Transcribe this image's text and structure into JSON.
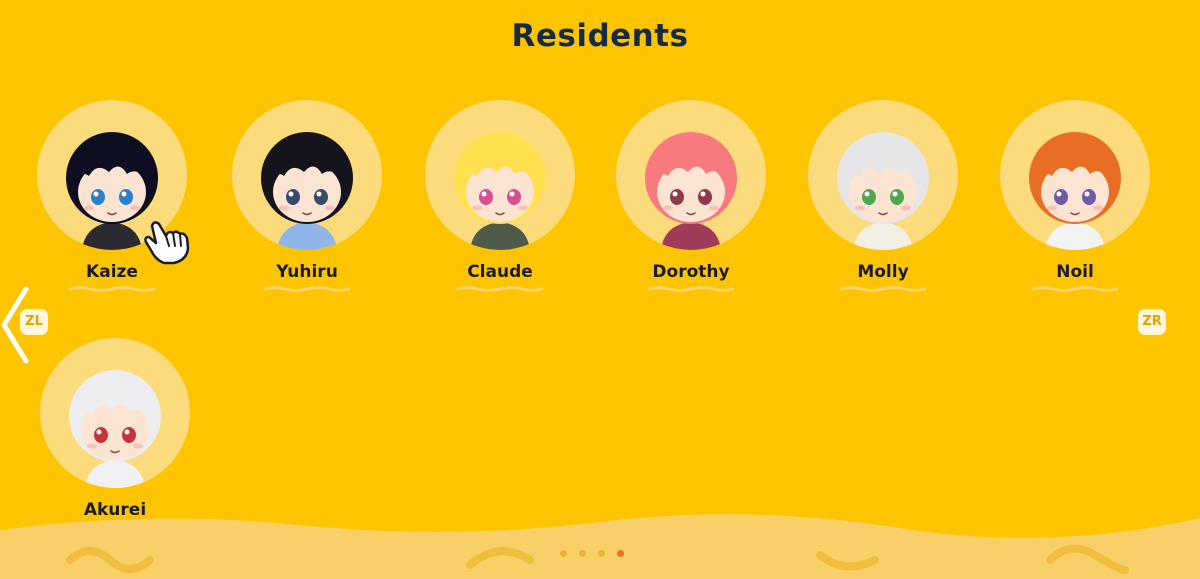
{
  "title": "Residents",
  "residents": [
    {
      "name": "Kaize",
      "hair": "#0E0E22",
      "skin": "#FBE4D2",
      "eyes": "#2E7FCB",
      "outfit": "#2A2A30"
    },
    {
      "name": "Yuhiru",
      "hair": "#15131C",
      "skin": "#FBE4D2",
      "eyes": "#3A4A6B",
      "outfit": "#8FB6E6"
    },
    {
      "name": "Claude",
      "hair": "#FFE14F",
      "skin": "#FBE4D2",
      "eyes": "#D84F8F",
      "outfit": "#4E5A4A"
    },
    {
      "name": "Dorothy",
      "hair": "#F77A7E",
      "skin": "#FBE4D2",
      "eyes": "#8E3A4C",
      "outfit": "#A03B5A"
    },
    {
      "name": "Molly",
      "hair": "#E6E6E8",
      "skin": "#FBE4D2",
      "eyes": "#4FA84F",
      "outfit": "#F2EFE5"
    },
    {
      "name": "Noil",
      "hair": "#E86E24",
      "skin": "#FBE4D2",
      "eyes": "#6C5BA5",
      "outfit": "#F3F3F3"
    },
    {
      "name": "Akurei",
      "hair": "#EDEDF0",
      "skin": "#FBE4D2",
      "eyes": "#C8323C",
      "outfit": "#F1F1F4"
    }
  ],
  "controls": {
    "zl_label": "ZL",
    "zr_label": "ZR"
  },
  "pagination": {
    "total": 4,
    "current": 4
  },
  "colors": {
    "background": "#FDC500",
    "portrait_bg": "#FCDB7D",
    "title": "#172A44",
    "active_dot": "#E8721C"
  }
}
